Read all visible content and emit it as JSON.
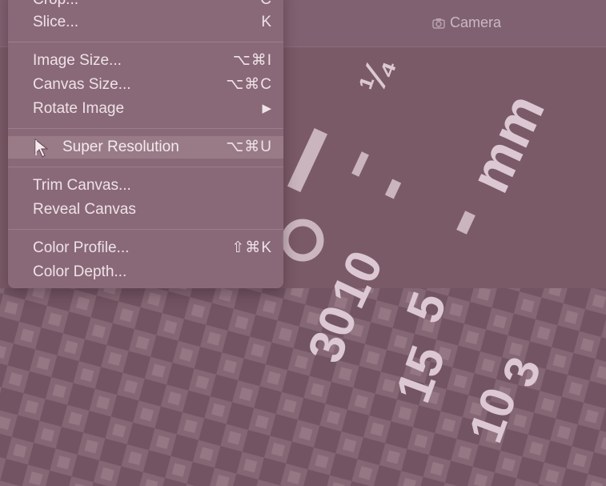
{
  "window": {
    "title": "Camera",
    "title_icon": "camera-icon"
  },
  "menu": {
    "items": [
      {
        "label": "Crop...",
        "shortcut": "C"
      },
      {
        "label": "Slice...",
        "shortcut": "K"
      },
      {
        "label": "Image Size...",
        "shortcut": "⌥⌘I"
      },
      {
        "label": "Canvas Size...",
        "shortcut": "⌥⌘C"
      },
      {
        "label": "Rotate Image",
        "shortcut": "▶"
      },
      {
        "label": "Super Resolution",
        "shortcut": "⌥⌘U"
      },
      {
        "label": "Trim Canvas...",
        "shortcut": ""
      },
      {
        "label": "Reveal Canvas",
        "shortcut": ""
      },
      {
        "label": "Color Profile...",
        "shortcut": "⇧⌘K"
      },
      {
        "label": "Color Depth...",
        "shortcut": ""
      }
    ]
  },
  "photo": {
    "dial_labels": [
      "¼",
      "mm",
      "10",
      "5",
      "30",
      "15",
      "3",
      "10"
    ]
  },
  "colors": {
    "menu_bg": "#8a6a78",
    "text": "#efe2e8",
    "photo_tint": "#7a5a67"
  }
}
